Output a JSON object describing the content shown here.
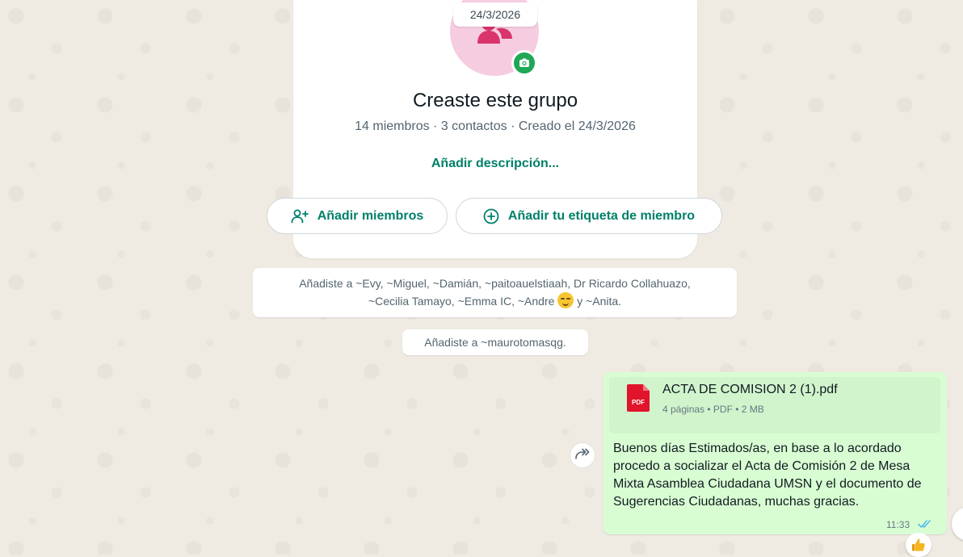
{
  "date_chip": "24/3/2026",
  "group": {
    "title": "Creaste este grupo",
    "meta": "14 miembros · 3 contactos · Creado el 24/3/2026",
    "add_description": "Añadir descripción...",
    "add_members_label": "Añadir miembros",
    "add_tag_label": "Añadir tu etiqueta de miembro"
  },
  "system_messages": {
    "added_1_line1": "Añadiste a ~Evy, ~Miguel, ~Damián, ~paitoauelstiaah, Dr Ricardo Collahuazo,",
    "added_1_line2_a": "~Cecilia Tamayo, ~Emma IC, ~Andre",
    "added_1_line2_b": "y ~Anita.",
    "added_2": "Añadiste a ~maurotomasqg."
  },
  "message": {
    "document": {
      "file_name": "ACTA DE COMISION 2 (1).pdf",
      "file_meta": "4 páginas • PDF • 2 MB",
      "type_badge": "PDF"
    },
    "text": "Buenos días Estimados/as, en base a lo acordado procedo a socializar el Acta de Comisión 2 de Mesa Mixta Asamblea Ciudadana UMSN y el documento de Sugerencias Ciudadanas, muchas gracias.",
    "time": "11:33",
    "status_icon": "double-check-read-icon",
    "reaction_icon": "thumbs-up-emoji"
  },
  "colors": {
    "accent_green": "#008069",
    "outgoing_bubble": "#d9fdd3",
    "read_ticks": "#53bdeb",
    "pdf_red": "#e0142a",
    "avatar_pink": "#f6cde0",
    "avatar_figure": "#d9346b"
  }
}
